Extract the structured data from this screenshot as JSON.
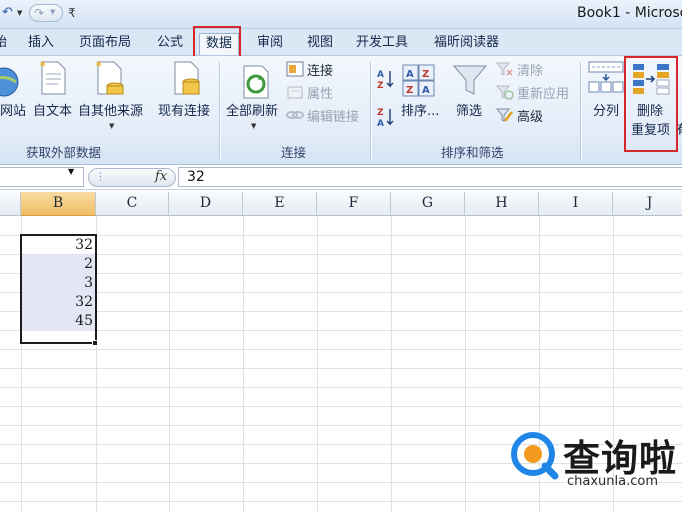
{
  "window": {
    "title": "Book1 - Microso",
    "qat_undo_glyph": "↶",
    "qat_redo_glyph": "↷",
    "qat_customize_glyph": "₹"
  },
  "ribbon_tabs": [
    {
      "label": "始",
      "active": false
    },
    {
      "label": "插入",
      "active": false
    },
    {
      "label": "页面布局",
      "active": false
    },
    {
      "label": "公式",
      "active": false
    },
    {
      "label": "数据",
      "active": true
    },
    {
      "label": "审阅",
      "active": false
    },
    {
      "label": "视图",
      "active": false
    },
    {
      "label": "开发工具",
      "active": false
    },
    {
      "label": "福昕阅读器",
      "active": false
    }
  ],
  "ribbon": {
    "get_external_data": {
      "group_label": "获取外部数据",
      "web": "网站",
      "text": "自文本",
      "other_sources": "自其他来源",
      "existing_connections": "现有连接"
    },
    "connections": {
      "group_label": "连接",
      "refresh_all": "全部刷新",
      "connections": "连接",
      "properties": "属性",
      "edit_links": "编辑链接"
    },
    "sort_filter": {
      "group_label": "排序和筛选",
      "sort": "排序...",
      "filter": "筛选",
      "clear": "清除",
      "reapply": "重新应用",
      "advanced": "高级"
    },
    "data_tools": {
      "text_to_columns": "分列",
      "remove_duplicates_line1": "删除",
      "remove_duplicates_line2": "重复项",
      "cutoff_char": "有"
    }
  },
  "formula_bar": {
    "name_box": "",
    "fx_label": "fx",
    "value": "32"
  },
  "columns": [
    "B",
    "C",
    "D",
    "E",
    "F",
    "G",
    "H",
    "I",
    "J"
  ],
  "selected_column": "B",
  "cells": [
    {
      "ref": "B2",
      "value": "32"
    },
    {
      "ref": "B3",
      "value": "2"
    },
    {
      "ref": "B4",
      "value": "3"
    },
    {
      "ref": "B5",
      "value": "32"
    },
    {
      "ref": "B6",
      "value": "45"
    }
  ],
  "watermark": {
    "name": "查询啦",
    "url": "chaxunla.com"
  },
  "colors": {
    "highlight": "#d6282c",
    "selected_header": "#f0bd64",
    "selection_fill": "#e3e7f5",
    "watermark_blue": "#1f86e8",
    "watermark_orange": "#f39a1e"
  }
}
